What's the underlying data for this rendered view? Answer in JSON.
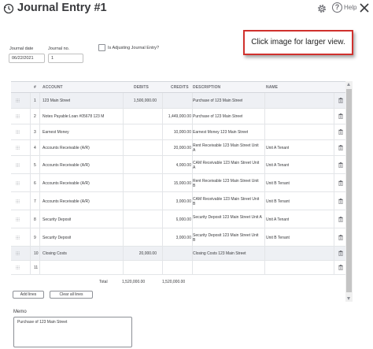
{
  "header": {
    "title": "Journal Entry #1",
    "help_label": "Help"
  },
  "form": {
    "journal_date_label": "Journal date",
    "journal_date_value": "06/22/2021",
    "journal_no_label": "Journal no.",
    "journal_no_value": "1",
    "adjusting_label": "Is Adjusting Journal Entry?"
  },
  "callout": {
    "text": "Click image for larger view."
  },
  "table": {
    "columns": [
      "#",
      "ACCOUNT",
      "DEBITS",
      "CREDITS",
      "DESCRIPTION",
      "NAME"
    ],
    "rows": [
      {
        "num": "1",
        "account": "123 Main Street",
        "debit": "1,500,000.00",
        "credit": "",
        "description": "Purchase of 123 Main Street",
        "name": ""
      },
      {
        "num": "2",
        "account": "Notes Payable:Loan #05678 123 M",
        "debit": "",
        "credit": "1,449,000.00",
        "description": "Purchase of 123 Main Street",
        "name": ""
      },
      {
        "num": "3",
        "account": "Earnest Money",
        "debit": "",
        "credit": "10,000.00",
        "description": "Earnest Money 123 Main Street",
        "name": ""
      },
      {
        "num": "4",
        "account": "Accounts Receivable (A/R)",
        "debit": "",
        "credit": "20,000.00",
        "description": "Rent Receivable 123 Main Street Unit A",
        "name": "Unit A Tenant"
      },
      {
        "num": "5",
        "account": "Accounts Receivable (A/R)",
        "debit": "",
        "credit": "4,000.00",
        "description": "CAM Receivable 123 Main Street Unit A",
        "name": "Unit A Tenant"
      },
      {
        "num": "6",
        "account": "Accounts Receivable (A/R)",
        "debit": "",
        "credit": "15,000.00",
        "description": "Rent Receivable 123 Main Street Unit B",
        "name": "Unit B Tenant"
      },
      {
        "num": "7",
        "account": "Accounts Receivable (A/R)",
        "debit": "",
        "credit": "3,000.00",
        "description": "CAM Receivable 123 Main Street Unit B",
        "name": "Unit B Tenant"
      },
      {
        "num": "8",
        "account": "Security Deposit",
        "debit": "",
        "credit": "6,000.00",
        "description": "Security Deposit 123 Main Street Unit A",
        "name": "Unit A Tenant"
      },
      {
        "num": "9",
        "account": "Security Deposit",
        "debit": "",
        "credit": "3,000.00",
        "description": "Security Deposit 123 Main Street Unit B",
        "name": "Unit B Tenant"
      },
      {
        "num": "10",
        "account": "Closing Costs",
        "debit": "20,000.00",
        "credit": "",
        "description": "Closing Costs 123 Main Street",
        "name": ""
      },
      {
        "num": "11",
        "account": "",
        "debit": "",
        "credit": "",
        "description": "",
        "name": ""
      }
    ],
    "total_label": "Total",
    "total_debits": "1,520,000.00",
    "total_credits": "1,520,000.00"
  },
  "buttons": {
    "add_lines": "Add lines",
    "clear_all_lines": "Clear all lines"
  },
  "memo": {
    "label": "Memo",
    "value": "Purchase of 123 Main Street"
  },
  "colors": {
    "callout_border": "#d0312d",
    "header_bg": "#f4f5f8",
    "shaded_row": "#eef0f4"
  }
}
